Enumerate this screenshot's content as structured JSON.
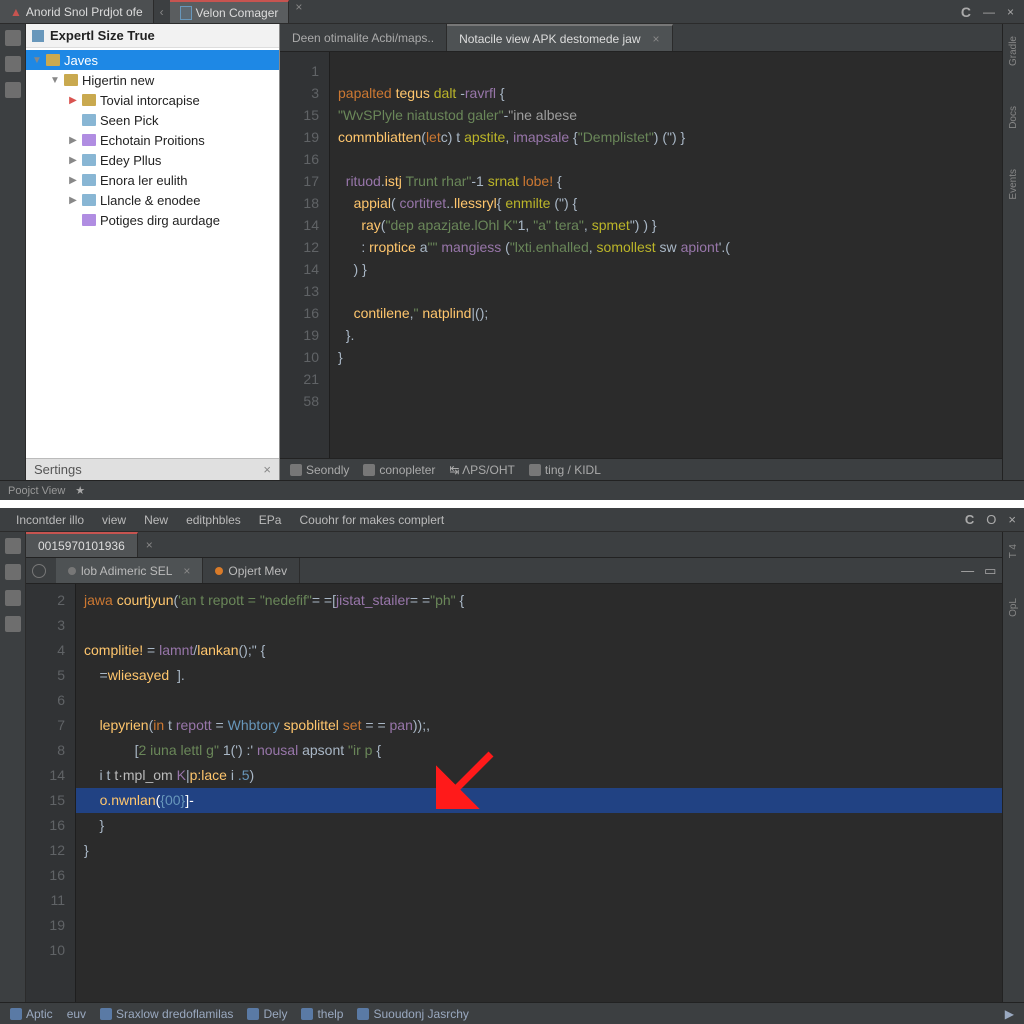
{
  "top": {
    "tabs": [
      {
        "label": "Anorid Snol Prdjot ofe"
      },
      {
        "label": "Velon Comager"
      }
    ],
    "win": {
      "c": "C",
      "min": "—",
      "close": "×"
    },
    "sidebar": {
      "head": "Expertl Size True",
      "tree": [
        {
          "depth": 0,
          "arrow": "down",
          "icon": "folder",
          "label": "Javes",
          "selected": true
        },
        {
          "depth": 1,
          "arrow": "down",
          "icon": "folder",
          "label": "Higertin new"
        },
        {
          "depth": 2,
          "arrow": "right",
          "arrowRed": true,
          "icon": "folder",
          "label": "Tovial intorcapise"
        },
        {
          "depth": 2,
          "arrow": "",
          "icon": "leaf",
          "label": "Seen Pick"
        },
        {
          "depth": 2,
          "arrow": "right",
          "icon": "pkg",
          "label": "Echotain Proitions"
        },
        {
          "depth": 2,
          "arrow": "right",
          "icon": "leaf",
          "label": "Edey Pllus"
        },
        {
          "depth": 2,
          "arrow": "right",
          "icon": "leaf",
          "label": "Enora ler eulith"
        },
        {
          "depth": 2,
          "arrow": "right",
          "icon": "leaf",
          "label": "Llancle & enodee"
        },
        {
          "depth": 2,
          "arrow": "",
          "icon": "pkg",
          "label": "Potiges dirg aurdage"
        }
      ],
      "foot": {
        "label": "Sertings",
        "close": "×"
      }
    },
    "subtabs": [
      {
        "label": "Deen otimalite Acbi/maps..",
        "active": false
      },
      {
        "label": "Notacile view APK destomede jaw",
        "active": true,
        "close": "×"
      }
    ],
    "gutter": [
      "1",
      "3",
      "15",
      "19",
      "16",
      "17",
      "18",
      "14",
      "12",
      "14",
      "13",
      "16",
      "19",
      "10",
      "21",
      "58"
    ],
    "code": [
      {
        "raw": ""
      },
      {
        "raw": "<k>papalted</k> <fn>tegus</fn> <y>dalt</y> -<c>ravrfl</c> {"
      },
      {
        "raw": "<s>\"WvSPlyle niatustod galer\"</s>-<m>\"ine albese</m>"
      },
      {
        "raw": "<fn>commbliatten</fn>(<k>let</k>c) t <y>apstite</y>, <c>imapsale</c> {<s>\"Demplistet\"</s>) (\") }"
      },
      {
        "raw": ""
      },
      {
        "raw": "  <c>rituod</c>.<fn>istj</fn> <s>Trunt rhar\"</s>-1 <y>srnat</y> <k>lobe!</k> {"
      },
      {
        "raw": "    <fn>appial</fn>( <c>cortitret</c>..<fn>llessryl</fn>{ <y>enmilte</y> (\") {"
      },
      {
        "raw": "      <fn>ray</fn>(<s>\"dep apazjate.lOhl K\"</s>1, <s>\"a\" tera\"</s>, <y>spmet</y>\") ) }"
      },
      {
        "raw": "      : <fn>rroptice</fn> a<s>\"\"</s> <c>mangiess</c> (<s>\"lxti.enhalled</s>, <y>somollest</y> sw <c>apiont</c>'.("
      },
      {
        "raw": "    ) }"
      },
      {
        "raw": ""
      },
      {
        "raw": "    <fn>contilene</fn>,<s>\"</s> <fn>natplind</fn>|();"
      },
      {
        "raw": "  }."
      },
      {
        "raw": "}"
      },
      {
        "raw": ""
      },
      {
        "raw": ""
      }
    ],
    "status": [
      {
        "label": "Seondly"
      },
      {
        "label": "conopleter"
      },
      {
        "label": "↹ ΛPS/OHT"
      },
      {
        "label": "ting / KIDL"
      }
    ],
    "bottomstrip": {
      "label": "Poojct View"
    },
    "rightRail": [
      "Gradle",
      "Docs",
      "Events"
    ]
  },
  "bot": {
    "menu": [
      "Incontder illo",
      "view",
      "New",
      "editphbles",
      "EPa",
      "Couohr for makes complert"
    ],
    "win": {
      "c": "C",
      "o": "O",
      "close": "×"
    },
    "topTab": "0015970101936",
    "subtabs": [
      {
        "dot": "gray",
        "label": "lob Adimeric SEL",
        "close": "×",
        "active": true
      },
      {
        "dot": "orange",
        "label": "Opjert Mev",
        "active": false
      }
    ],
    "innerWin": {
      "min": "—",
      "max": "▭",
      "close": "×"
    },
    "gutter": [
      "2",
      "3",
      "4",
      "5",
      "6",
      "7",
      "8",
      "14",
      "15",
      "16",
      "12",
      "16",
      "11",
      "19",
      "10",
      " "
    ],
    "code": [
      {
        "raw": "<k>jawa</k> <fn>courtjyun</fn>(<s>'an t repott = \"nedefif\"</s>= =[<c>jistat_stailer</c>= =<s>\"ph\"</s> {"
      },
      {
        "raw": ""
      },
      {
        "raw": "<fn>complitie!</fn> = <c>lamnt</c>/<fn>lankan</fn>();\" {"
      },
      {
        "raw": "    =<fn>wliesayed</fn>  ]."
      },
      {
        "raw": ""
      },
      {
        "raw": "    <fn>lepyrien</fn>(<k>in</k> t <c>repott</c> = <n>Whbtory</n> <fn>spoblittel</fn> <k>set</k> = = <c>pan</c>));,"
      },
      {
        "raw": "             [<s>2 iuna lettl g\"</s> 1(') :' <c>nousal</c> <y>apsont</y> <s>\"ir p</s> {"
      },
      {
        "raw": "    i t <w>t·mpl_om</w> <c>K</c>|<fn>p:lace</fn> i <n>.5</n>)"
      },
      {
        "hl": true,
        "raw": "    <fn>o.nwnlan</fn>(<n>{00}</n>]-"
      },
      {
        "raw": "    }"
      },
      {
        "raw": "}"
      },
      {
        "raw": ""
      },
      {
        "raw": ""
      },
      {
        "raw": ""
      },
      {
        "raw": ""
      },
      {
        "raw": ""
      }
    ],
    "status": [
      {
        "label": "Aptic"
      },
      {
        "label": "euv"
      },
      {
        "label": "Sraxlow dredoflamilas"
      },
      {
        "label": "Dely"
      },
      {
        "label": "thelp"
      },
      {
        "label": "Suoudonj Jasrchy"
      }
    ],
    "rightRail": [
      "T  4",
      "OpL"
    ]
  }
}
